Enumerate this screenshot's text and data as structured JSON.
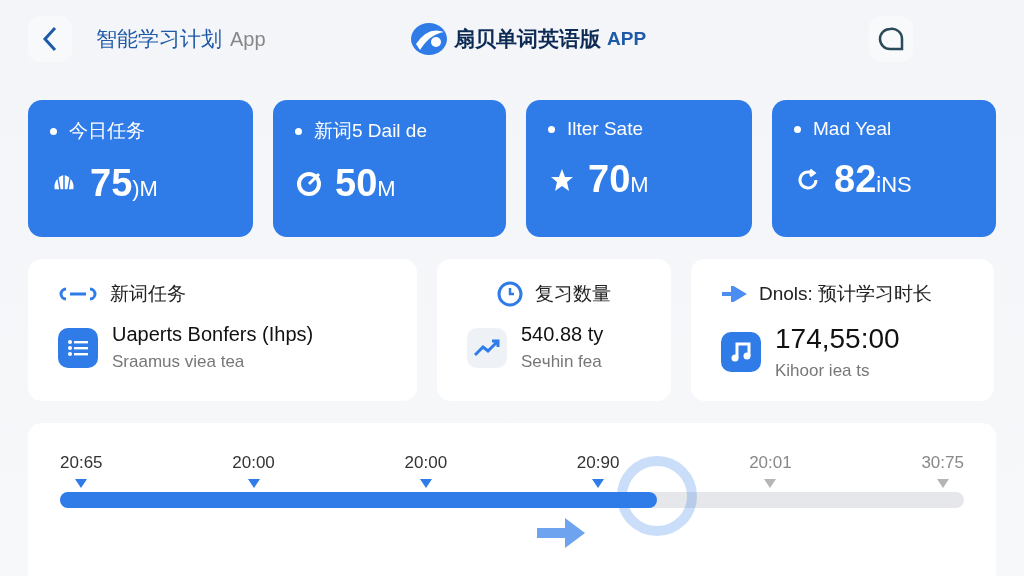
{
  "header": {
    "title": "智能学习计划",
    "title_suffix": "App",
    "app_name": "扇贝单词英语版",
    "app_name_suffix": "APP"
  },
  "stats": [
    {
      "label": "今日任务",
      "value": "75",
      "unit": ")M"
    },
    {
      "label": "新词5 Dail de",
      "value": "50",
      "unit": "M"
    },
    {
      "label": "Ilter Sate",
      "value": "70",
      "unit": "M"
    },
    {
      "label": "Mad Yeal",
      "value": "82",
      "unit": "iNS"
    }
  ],
  "info_cards": [
    {
      "title": "新词任务",
      "main": "Uaperts Bonfers (Ihps)",
      "sub": "Sraamus viea tea"
    },
    {
      "title": "复习数量",
      "main": "540.88 ty",
      "sub": "Seчhin fea"
    },
    {
      "title": "Dnols: 预计学习时长",
      "main": "174,55:00",
      "sub": "Kihoor iea ts"
    }
  ],
  "timeline": {
    "level": 0.66,
    "markers": [
      {
        "label": "20:65",
        "reached": true
      },
      {
        "label": "20:00",
        "reached": true
      },
      {
        "label": "20:00",
        "reached": true
      },
      {
        "label": "20:90",
        "reached": true
      },
      {
        "label": "20:01",
        "reached": false
      },
      {
        "label": "30:75",
        "reached": false
      }
    ]
  }
}
